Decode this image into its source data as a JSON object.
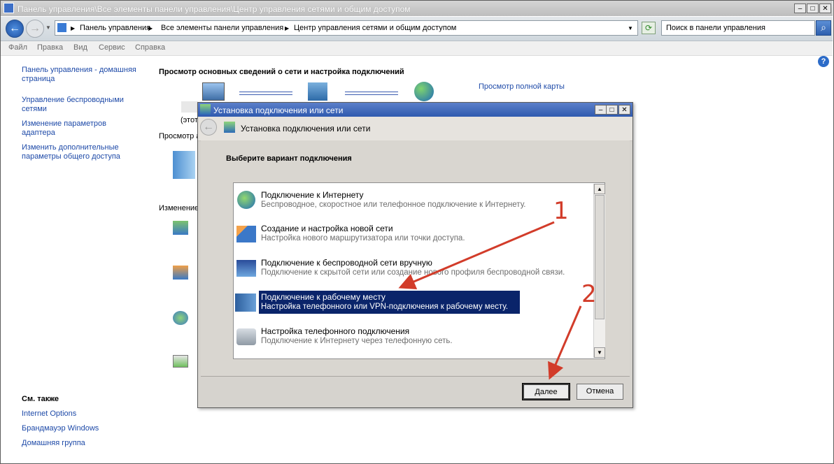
{
  "window": {
    "title": "Панель управления\\Все элементы панели управления\\Центр управления сетями и общим доступом"
  },
  "address": {
    "crumbs": [
      "Панель управления",
      "Все элементы панели управления",
      "Центр управления сетями и общим доступом"
    ]
  },
  "search": {
    "placeholder": "Поиск в панели управления"
  },
  "menu": [
    "Файл",
    "Правка",
    "Вид",
    "Сервис",
    "Справка"
  ],
  "sidebar": {
    "links": [
      "Панель управления - домашняя страница",
      "Управление беспроводными сетями",
      "Изменение параметров адаптера",
      "Изменить дополнительные параметры общего доступа"
    ],
    "see_also_heading": "См. также",
    "see_also": [
      "Internet Options",
      "Брандмауэр Windows",
      "Домашняя группа"
    ]
  },
  "main": {
    "heading": "Просмотр основных сведений о сети и настройка подключений",
    "full_map_link": "Просмотр полной карты",
    "partial_this": "(этот",
    "partial_view": "Просмотр а",
    "partial_change": "Изменение"
  },
  "dialog": {
    "title": "Установка подключения или сети",
    "header": "Установка подключения или сети",
    "prompt": "Выберите вариант подключения",
    "options": [
      {
        "title": "Подключение к Интернету",
        "desc": "Беспроводное, скоростное или телефонное подключение к Интернету.",
        "icon": "internet-globe-icon"
      },
      {
        "title": "Создание и настройка новой сети",
        "desc": "Настройка нового маршрутизатора или точки доступа.",
        "icon": "new-network-icon"
      },
      {
        "title": "Подключение к беспроводной сети вручную",
        "desc": "Подключение к скрытой сети или создание нового профиля беспроводной связи.",
        "icon": "wireless-icon"
      },
      {
        "title": "Подключение к рабочему месту",
        "desc": "Настройка телефонного или VPN-подключения к рабочему месту.",
        "icon": "workplace-icon",
        "selected": true
      },
      {
        "title": "Настройка телефонного подключения",
        "desc": "Подключение к Интернету через телефонную сеть.",
        "icon": "dialup-phone-icon"
      }
    ],
    "next_label": "Далее",
    "cancel_label": "Отмена"
  },
  "annotations": {
    "marker_1": "1",
    "marker_2": "2"
  },
  "colors": {
    "link": "#1e4aa8",
    "selection": "#0a246a",
    "annotation": "#d23c2a"
  }
}
